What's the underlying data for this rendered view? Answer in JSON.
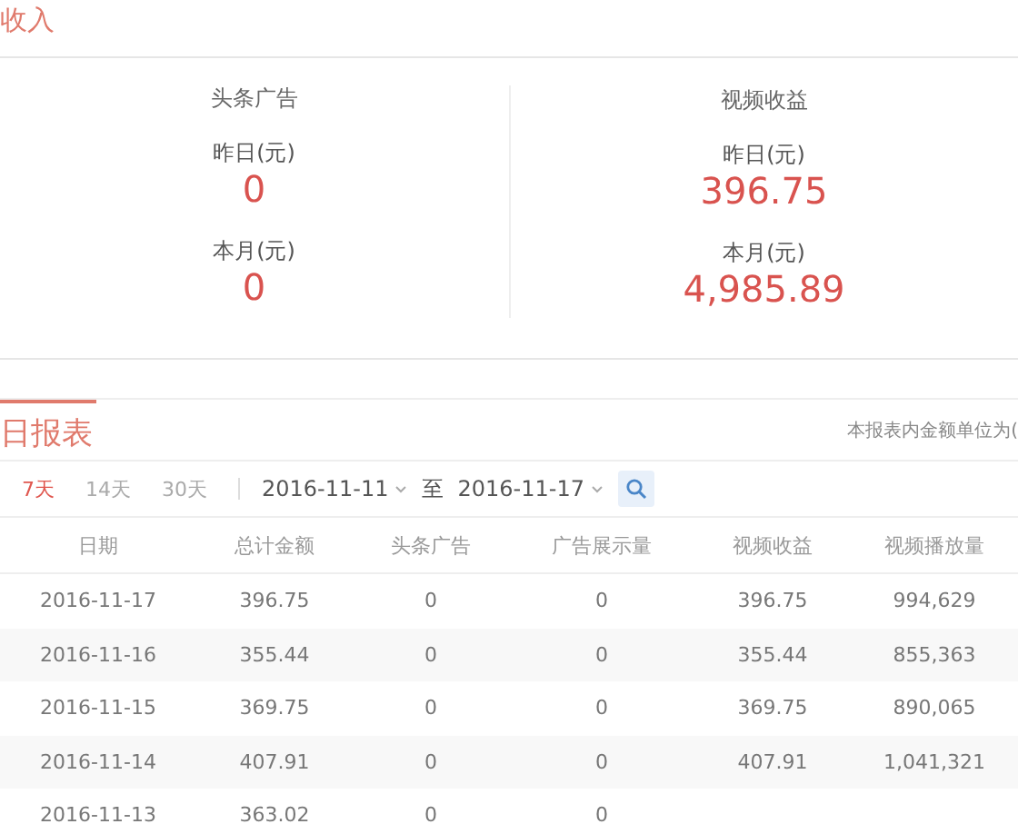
{
  "income": {
    "title": "收入",
    "groups": [
      {
        "name": "头条广告",
        "stats": [
          {
            "label": "昨日(元)",
            "value": "0"
          },
          {
            "label": "本月(元)",
            "value": "0"
          }
        ]
      },
      {
        "name": "视频收益",
        "stats": [
          {
            "label": "昨日(元)",
            "value": "396.75"
          },
          {
            "label": "本月(元)",
            "value": "4,985.89"
          }
        ]
      }
    ]
  },
  "report": {
    "title": "日报表",
    "note": "本报表内金额单位为(",
    "ranges": [
      {
        "label": "7天",
        "selected": true
      },
      {
        "label": "14天",
        "selected": false
      },
      {
        "label": "30天",
        "selected": false
      }
    ],
    "date_from": "2016-11-11",
    "date_to_label": "至",
    "date_to": "2016-11-17",
    "columns": [
      "日期",
      "总计金额",
      "头条广告",
      "广告展示量",
      "视频收益",
      "视频播放量"
    ],
    "rows": [
      [
        "2016-11-17",
        "396.75",
        "0",
        "0",
        "396.75",
        "994,629"
      ],
      [
        "2016-11-16",
        "355.44",
        "0",
        "0",
        "355.44",
        "855,363"
      ],
      [
        "2016-11-15",
        "369.75",
        "0",
        "0",
        "369.75",
        "890,065"
      ],
      [
        "2016-11-14",
        "407.91",
        "0",
        "0",
        "407.91",
        "1,041,321"
      ],
      [
        "2016-11-13",
        "363.02",
        "0",
        "0"
      ]
    ]
  }
}
